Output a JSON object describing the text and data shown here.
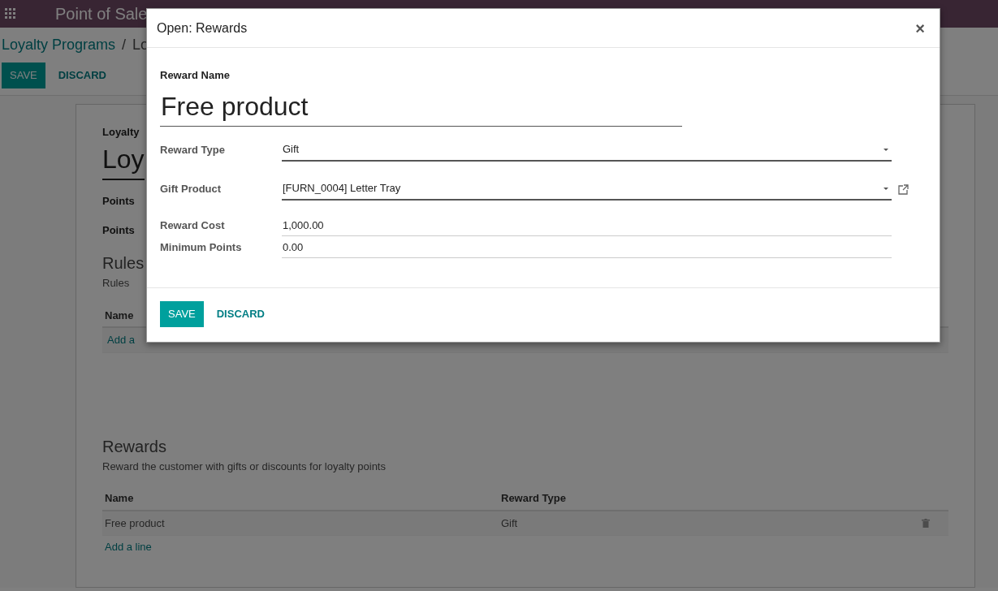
{
  "navbar": {
    "app_title": "Point of Sale"
  },
  "breadcrumb": {
    "parent": "Loyalty Programs",
    "separator": "/",
    "current": "Lo"
  },
  "buttons": [
    "SAVE",
    "DISCARD"
  ],
  "sheet": {
    "title_label": "Loyalty",
    "title": "Loy",
    "fields": [
      "Points",
      "Points"
    ],
    "rules": {
      "heading": "Rules",
      "description": "Rules",
      "columns": [
        "Name"
      ],
      "add_line": "Add a"
    },
    "rewards": {
      "heading": "Rewards",
      "description": "Reward the customer with gifts or discounts for loyalty points",
      "columns": [
        "Name",
        "Reward Type"
      ],
      "rows": [
        {
          "name": "Free product",
          "reward_type": "Gift"
        }
      ],
      "add_line": "Add a line"
    }
  },
  "dialog": {
    "title": "Open: Rewards",
    "close": "×",
    "name_label": "Reward Name",
    "name_value": "Free product",
    "fields": [
      {
        "label": "Reward Type",
        "value": "Gift",
        "kind": "select",
        "required": true
      },
      {
        "label": "Gift Product",
        "value": "[FURN_0004] Letter Tray",
        "kind": "many2one",
        "required": true
      },
      {
        "label": "Reward Cost",
        "value": "1,000.00",
        "kind": "input",
        "required": false
      },
      {
        "label": "Minimum Points",
        "value": "0.00",
        "kind": "input",
        "required": false
      }
    ],
    "buttons": [
      "SAVE",
      "DISCARD"
    ]
  }
}
